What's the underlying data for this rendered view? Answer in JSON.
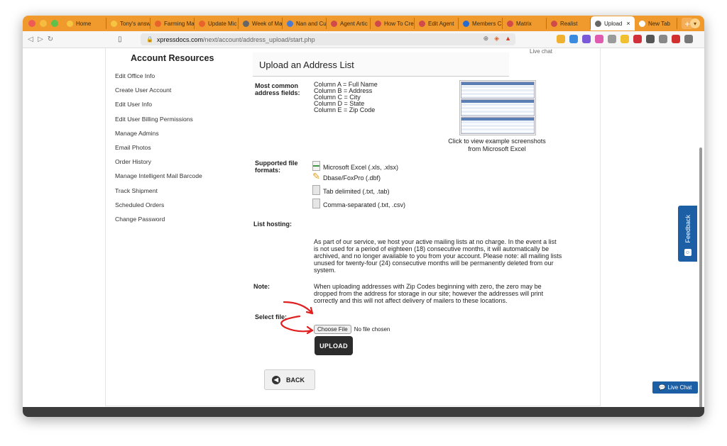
{
  "browser": {
    "tabs": [
      {
        "label": "Home",
        "color": "#f5c542"
      },
      {
        "label": "Tony's answ",
        "color": "#f5c542"
      },
      {
        "label": "Farming Ma",
        "color": "#e8632b"
      },
      {
        "label": "Update Mic",
        "color": "#e8632b"
      },
      {
        "label": "Week of Ma",
        "color": "#666666"
      },
      {
        "label": "Nan and Cu",
        "color": "#4a7bd0"
      },
      {
        "label": "Agent Artic",
        "color": "#d04a4a"
      },
      {
        "label": "How To Cre",
        "color": "#d04a4a"
      },
      {
        "label": "Edit Agent",
        "color": "#d04a4a"
      },
      {
        "label": "Members C",
        "color": "#2a6bd0"
      },
      {
        "label": "Matrix",
        "color": "#d04a4a"
      },
      {
        "label": "Realist",
        "color": "#d04a4a"
      },
      {
        "label": "Upload",
        "color": "#666666"
      },
      {
        "label": "New Tab",
        "color": "#ffffff"
      }
    ],
    "url_host": "xpressdocs.com",
    "url_path": "/next/account/address_upload/start.php"
  },
  "sidebar": {
    "title": "Account Resources",
    "items": [
      "Edit Office Info",
      "Create User Account",
      "Edit User Info",
      "Edit User Billing Permissions",
      "Manage Admins",
      "Email Photos",
      "Order History",
      "Manage Intelligent Mail Barcode",
      "Track Shipment",
      "Scheduled Orders",
      "Change Password"
    ]
  },
  "main": {
    "title": "Upload an Address List",
    "live_chat_link": "Live chat",
    "common_fields_label": "Most common address fields:",
    "columns": [
      "Column A = Full Name",
      "Column B = Address",
      "Column C = City",
      "Column D = State",
      "Column E = Zip Code"
    ],
    "screenshot_caption_line1": "Click to view example screenshots",
    "screenshot_caption_line2": "from Microsoft Excel",
    "formats_label": "Supported file formats:",
    "formats": [
      "Microsoft Excel (.xls, .xlsx)",
      "Dbase/FoxPro (.dbf)",
      "Tab delimited (.txt, .tab)",
      "Comma-separated (.txt, .csv)"
    ],
    "hosting_label": "List hosting:",
    "hosting_text": "As part of our service, we host your active mailing lists at no charge. In the event a list is not used for a period of eighteen (18) consecutive months, it will automatically be archived, and no longer available to you from your account. Please note: all mailing lists unused for twenty-four (24) consecutive months will be permanently deleted from our system.",
    "note_label": "Note:",
    "note_text": "When uploading addresses with Zip Codes beginning with zero, the zero may be dropped from the address for storage in our site; however the addresses will print correctly and this will not affect delivery of mailers to these locations.",
    "select_file_label": "Select file:",
    "choose_file_button": "Choose File",
    "no_file_text": "No file chosen",
    "upload_button": "UPLOAD",
    "back_button": "BACK"
  },
  "widgets": {
    "feedback": "Feedback",
    "live_chat_button": "Live Chat"
  }
}
